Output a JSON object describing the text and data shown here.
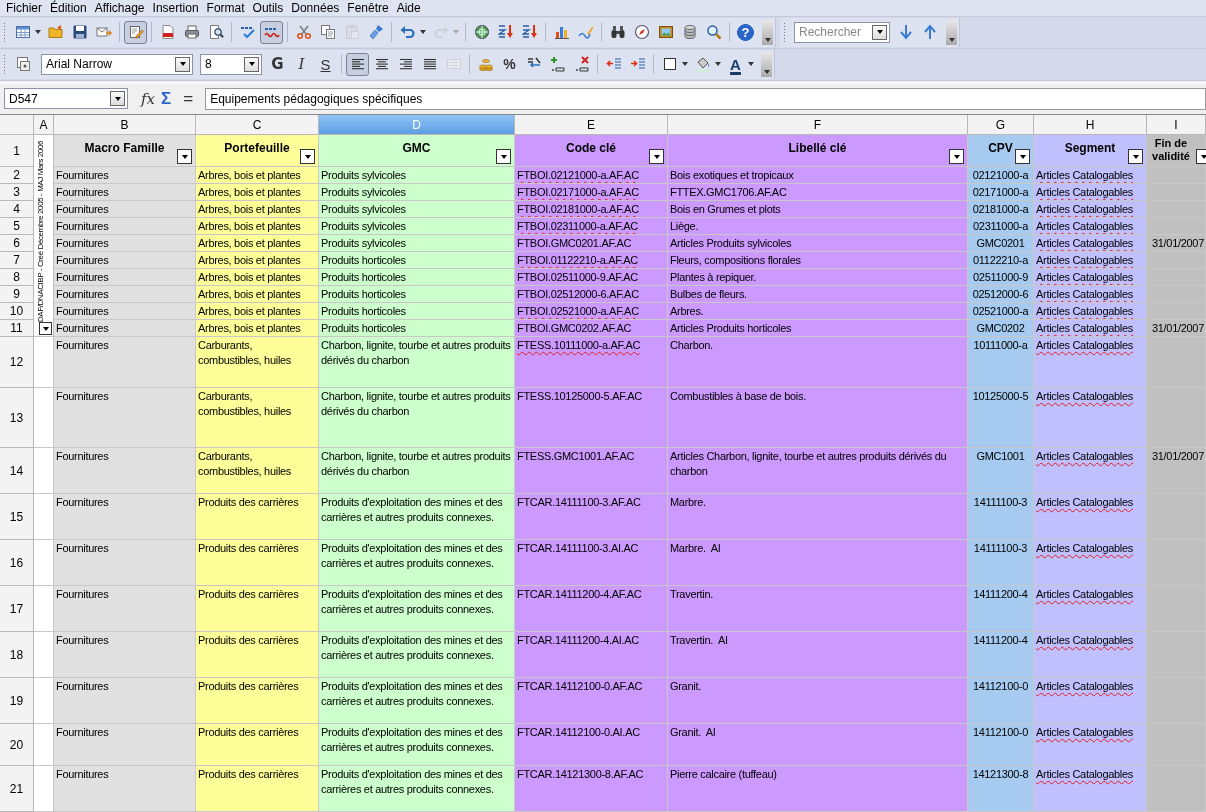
{
  "menu": [
    "Fichier",
    "Édition",
    "Affichage",
    "Insertion",
    "Format",
    "Outils",
    "Données",
    "Fenêtre",
    "Aide"
  ],
  "standard_toolbar": {
    "edit_file": {
      "pressed": true
    },
    "autospell": {
      "pressed": true
    },
    "paste": {
      "disabled": true
    },
    "redo": {
      "disabled": true
    },
    "help_label": "?"
  },
  "find_toolbar": {
    "placeholder": "Rechercher"
  },
  "formatting_toolbar": {
    "font_name": "Arial Narrow",
    "font_size": "8",
    "bold_label": "G",
    "italic_label": "I",
    "underline_label": "S",
    "align_left": {
      "pressed": true
    },
    "merge_cells": {
      "disabled": true
    },
    "percent_label": "%",
    "font_color_label": "A"
  },
  "formula_bar": {
    "cell_reference": "D547",
    "function_wizard_label": "fx",
    "sum_label": "Σ",
    "equals_label": "=",
    "content": "Equipements pédagogiques spécifiques"
  },
  "sheet": {
    "column_headers": [
      {
        "label": "A",
        "selected": false
      },
      {
        "label": "B",
        "selected": false
      },
      {
        "label": "C",
        "selected": false
      },
      {
        "label": "D",
        "selected": true
      },
      {
        "label": "E",
        "selected": false
      },
      {
        "label": "F",
        "selected": false
      },
      {
        "label": "G",
        "selected": false
      },
      {
        "label": "H",
        "selected": false
      },
      {
        "label": "I",
        "selected": false
      }
    ],
    "header_row": {
      "number": "1",
      "cells": [
        {
          "title": "Macro Famille",
          "color": "#e0e0e0"
        },
        {
          "title": "Portefeuille",
          "color": "#ffff99"
        },
        {
          "title": "GMC",
          "color": "#ccffcc"
        },
        {
          "title": "Code clé",
          "color": "#cc99ff"
        },
        {
          "title": "Libellé clé",
          "color": "#cc99ff"
        },
        {
          "title": "CPV",
          "color": "#a6caf0"
        },
        {
          "title": "Segment",
          "color": "#c0c0ff"
        },
        {
          "title": "Fin de validité",
          "color": "#c0c0c0"
        }
      ]
    },
    "merged_note": "DAF/DNACIBP - Créé Décembre 2005 - MAJ Mars 2006",
    "rows": [
      {
        "number": "2",
        "code_misspelled": true,
        "segment_misspelled": true,
        "cells": [
          "Fournitures",
          "Arbres, bois et plantes",
          "Produits sylvicoles",
          "FTBOI.02121000-a.AF.AC",
          "Bois exotiques et tropicaux",
          "02121000-a",
          "Articles Catalogables"
        ]
      },
      {
        "number": "3",
        "code_misspelled": true,
        "segment_misspelled": true,
        "cells": [
          "Fournitures",
          "Arbres, bois et plantes",
          "Produits sylvicoles",
          "FTBOI.02171000-a.AF.AC",
          "FTTEX.GMC1706.AF.AC",
          "02171000-a",
          "Articles Catalogables"
        ]
      },
      {
        "number": "4",
        "code_misspelled": true,
        "segment_misspelled": true,
        "cells": [
          "Fournitures",
          "Arbres, bois et plantes",
          "Produits sylvicoles",
          "FTBOI.02181000-a.AF.AC",
          "Bois en Grumes et plots",
          "02181000-a",
          "Articles Catalogables"
        ]
      },
      {
        "number": "5",
        "code_misspelled": true,
        "segment_misspelled": true,
        "cells": [
          "Fournitures",
          "Arbres, bois et plantes",
          "Produits sylvicoles",
          "FTBOI.02311000-a.AF.AC",
          "Liège.",
          "02311000-a",
          "Articles Catalogables"
        ]
      },
      {
        "number": "6",
        "code_misspelled": false,
        "segment_misspelled": true,
        "cells": [
          "Fournitures",
          "Arbres, bois et plantes",
          "Produits sylvicoles",
          "FTBOI.GMC0201.AF.AC",
          "Articles Produits sylvicoles",
          "GMC0201",
          "Articles Catalogables",
          "31/01/2007"
        ]
      },
      {
        "number": "7",
        "code_misspelled": true,
        "segment_misspelled": true,
        "cells": [
          "Fournitures",
          "Arbres, bois et plantes",
          "Produits horticoles",
          "FTBOI.01122210-a.AF.AC",
          "Fleurs, compositions florales",
          "01122210-a",
          "Articles Catalogables"
        ]
      },
      {
        "number": "8",
        "code_misspelled": false,
        "segment_misspelled": true,
        "cells": [
          "Fournitures",
          "Arbres, bois et plantes",
          "Produits horticoles",
          "FTBOI.02511000-9.AF.AC",
          "Plantes à repiquer.",
          "02511000-9",
          "Articles Catalogables"
        ]
      },
      {
        "number": "9",
        "code_misspelled": false,
        "segment_misspelled": true,
        "cells": [
          "Fournitures",
          "Arbres, bois et plantes",
          "Produits horticoles",
          "FTBOI.02512000-6.AF.AC",
          "Bulbes de fleurs.",
          "02512000-6",
          "Articles Catalogables"
        ]
      },
      {
        "number": "10",
        "code_misspelled": true,
        "segment_misspelled": true,
        "cells": [
          "Fournitures",
          "Arbres, bois et plantes",
          "Produits horticoles",
          "FTBOI.02521000-a.AF.AC",
          "Arbres.",
          "02521000-a",
          "Articles Catalogables"
        ]
      },
      {
        "number": "11",
        "code_misspelled": false,
        "segment_misspelled": true,
        "cells": [
          "Fournitures",
          "Arbres, bois et plantes",
          "Produits horticoles",
          "FTBOI.GMC0202.AF.AC",
          "Articles Produits horticoles",
          "GMC0202",
          "Articles Catalogables",
          "31/01/2007"
        ]
      },
      {
        "number": "12",
        "code_misspelled": true,
        "segment_misspelled": true,
        "cells": [
          "Fournitures",
          "Carburants, combustibles, huiles",
          "Charbon, lignite, tourbe et autres produits dérivés du charbon",
          "FTESS.10111000-a.AF.AC",
          "Charbon.",
          "10111000-a",
          "Articles Catalogables"
        ]
      },
      {
        "number": "13",
        "code_misspelled": false,
        "segment_misspelled": true,
        "cells": [
          "Fournitures",
          "Carburants, combustibles, huiles",
          "Charbon, lignite, tourbe et autres produits dérivés du charbon",
          "FTESS.10125000-5.AF.AC",
          "Combustibles à base de bois.",
          "10125000-5",
          "Articles Catalogables"
        ]
      },
      {
        "number": "14",
        "code_misspelled": false,
        "segment_misspelled": true,
        "cells": [
          "Fournitures",
          "Carburants, combustibles, huiles",
          "Charbon, lignite, tourbe et autres produits dérivés du charbon",
          "FTESS.GMC1001.AF.AC",
          "Articles Charbon, lignite, tourbe et autres produits dérivés du charbon",
          "GMC1001",
          "Articles Catalogables",
          "31/01/2007"
        ]
      },
      {
        "number": "15",
        "code_misspelled": false,
        "segment_misspelled": true,
        "cells": [
          "Fournitures",
          "Produits des carrières",
          "Produits d'exploitation des mines et des carrières et autres produits connexes.",
          "FTCAR.14111100-3.AF.AC",
          "Marbre.",
          "14111100-3",
          "Articles Catalogables"
        ]
      },
      {
        "number": "16",
        "code_misspelled": false,
        "segment_misspelled": true,
        "cells": [
          "Fournitures",
          "Produits des carrières",
          "Produits d'exploitation des mines et des carrières et autres produits connexes.",
          "FTCAR.14111100-3.AI.AC",
          "Marbre.  AI",
          "14111100-3",
          "Articles Catalogables"
        ]
      },
      {
        "number": "17",
        "code_misspelled": false,
        "segment_misspelled": true,
        "cells": [
          "Fournitures",
          "Produits des carrières",
          "Produits d'exploitation des mines et des carrières et autres produits connexes.",
          "FTCAR.14111200-4.AF.AC",
          "Travertin.",
          "14111200-4",
          "Articles Catalogables"
        ]
      },
      {
        "number": "18",
        "code_misspelled": false,
        "segment_misspelled": true,
        "cells": [
          "Fournitures",
          "Produits des carrières",
          "Produits d'exploitation des mines et des carrières et autres produits connexes.",
          "FTCAR.14111200-4.AI.AC",
          "Travertin.  AI",
          "14111200-4",
          "Articles Catalogables"
        ]
      },
      {
        "number": "19",
        "code_misspelled": false,
        "segment_misspelled": true,
        "cells": [
          "Fournitures",
          "Produits des carrières",
          "Produits d'exploitation des mines et des carrières et autres produits connexes.",
          "FTCAR.14112100-0.AF.AC",
          "Granit.",
          "14112100-0",
          "Articles Catalogables"
        ]
      },
      {
        "number": "20",
        "code_misspelled": false,
        "segment_misspelled": true,
        "cells": [
          "Fournitures",
          "Produits des carrières",
          "Produits d'exploitation des mines et des carrières et autres produits connexes.",
          "FTCAR.14112100-0.AI.AC",
          "Granit.  AI",
          "14112100-0",
          "Articles Catalogables"
        ]
      },
      {
        "number": "21",
        "code_misspelled": false,
        "segment_misspelled": true,
        "cells": [
          "Fournitures",
          "Produits des carrières",
          "Produits d'exploitation des mines et des carrières et autres produits connexes.",
          "FTCAR.14121300-8.AF.AC",
          "Pierre calcaire (tuffeau)",
          "14121300-8",
          "Articles Catalogables"
        ]
      }
    ]
  }
}
